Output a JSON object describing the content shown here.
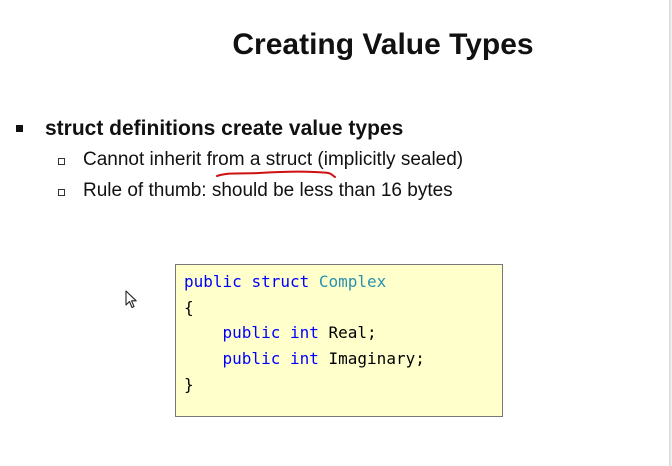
{
  "slide": {
    "title": "Creating Value Types",
    "main_bullet": "struct definitions create value types",
    "sub_bullets": [
      {
        "before": "Cannot inherit ",
        "underlined": "from a struct",
        "after": " (implicitly sealed)"
      },
      {
        "text": "Rule of thumb: should be less than 16 bytes"
      }
    ]
  },
  "code": {
    "line1": {
      "kw1": "public",
      "kw2": "struct",
      "type_name": "Complex"
    },
    "open_brace": "{",
    "field1": {
      "kw1": "public",
      "kw2": "int",
      "name": "Real;"
    },
    "field2": {
      "kw1": "public",
      "kw2": "int",
      "name": "Imaginary;"
    },
    "close_brace": "}"
  },
  "colors": {
    "keyword": "#0000ff",
    "type": "#2b91af",
    "code_background": "#ffffcc",
    "annotation_ink": "#d01010"
  },
  "icons": [
    "mouse-pointer-icon",
    "bullet-square-icon",
    "hollow-square-bullet-icon"
  ]
}
